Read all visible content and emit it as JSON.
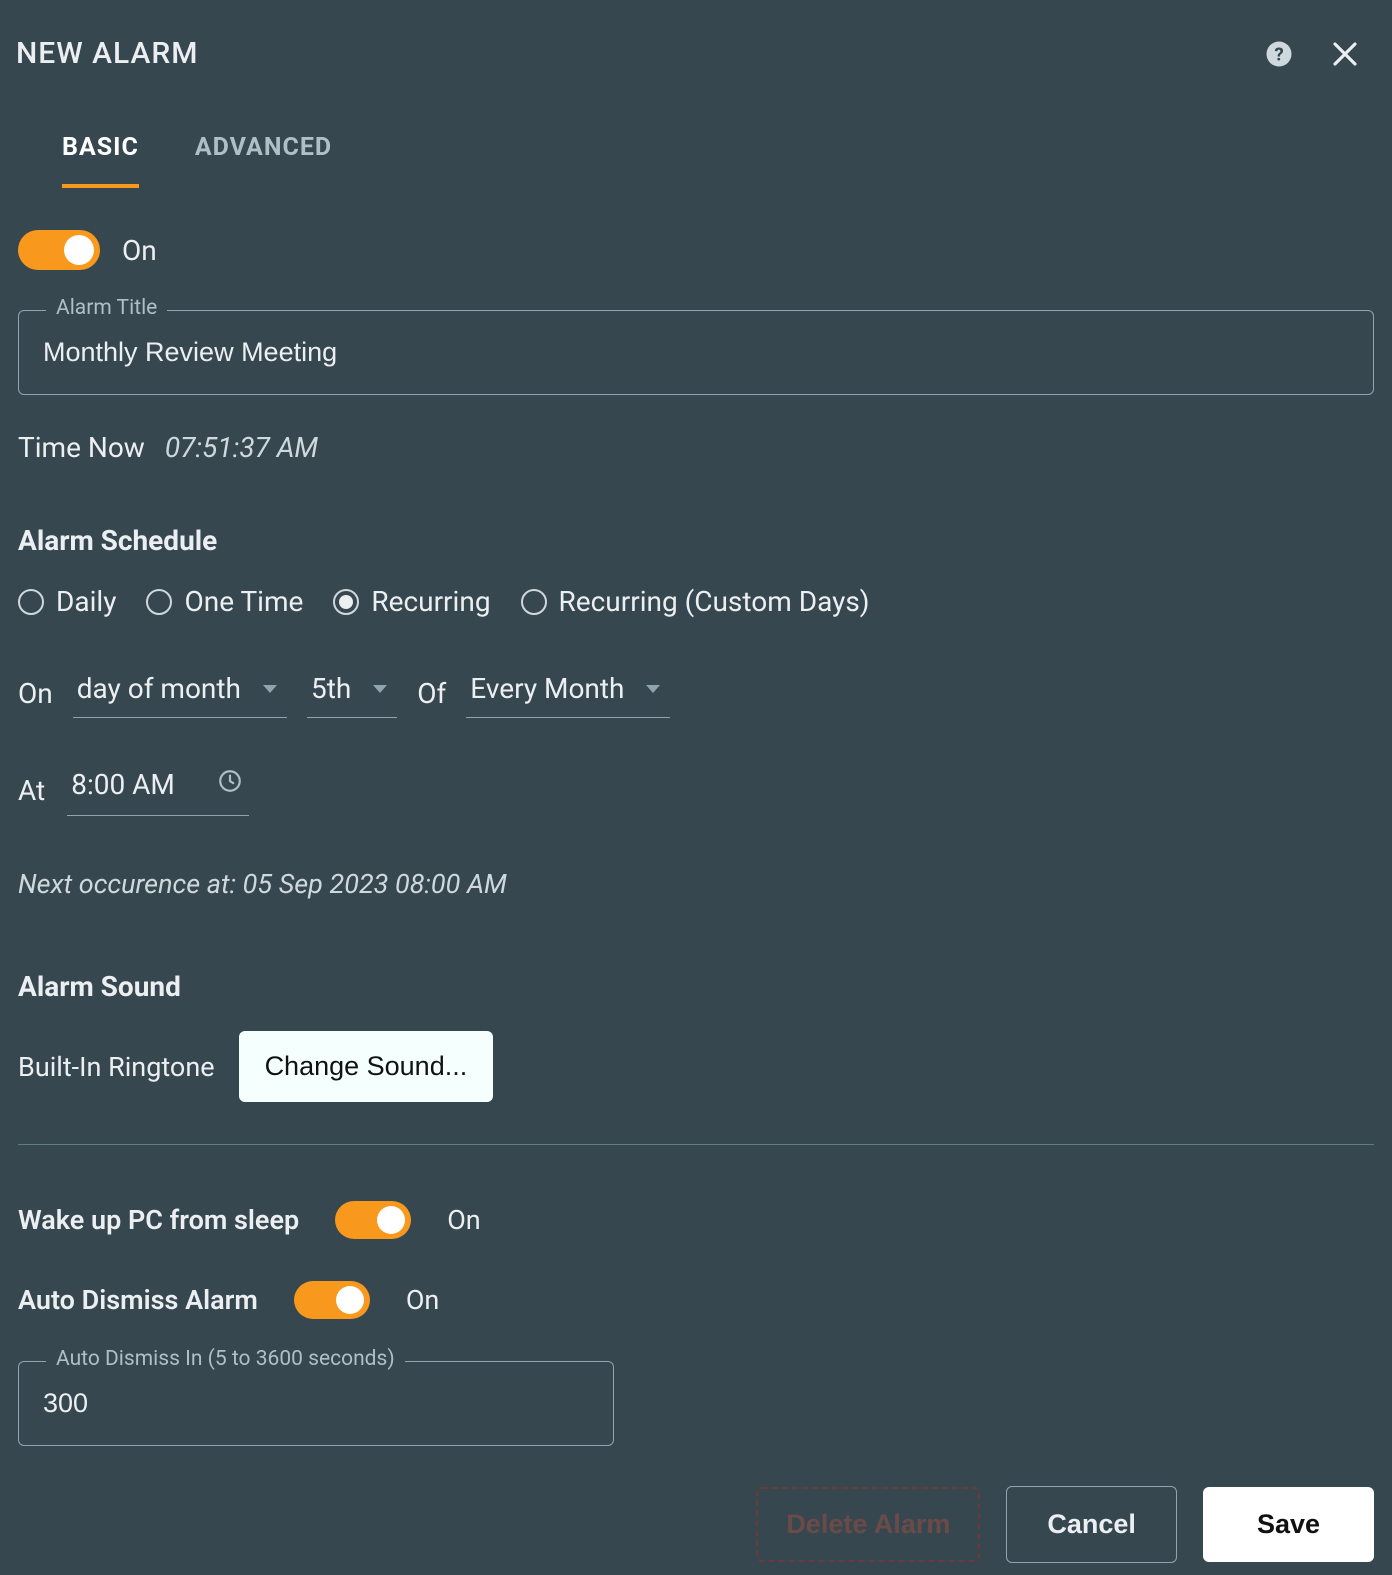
{
  "header": {
    "title": "NEW ALARM"
  },
  "tabs": {
    "basic": "BASIC",
    "advanced": "ADVANCED"
  },
  "enabled": {
    "label": "On"
  },
  "title_field": {
    "label": "Alarm Title",
    "value": "Monthly Review Meeting"
  },
  "time_now": {
    "label": "Time Now",
    "value": "07:51:37 AM"
  },
  "schedule": {
    "heading": "Alarm Schedule",
    "options": {
      "daily": "Daily",
      "one_time": "One Time",
      "recurring": "Recurring",
      "recurring_custom": "Recurring (Custom Days)"
    },
    "selected": "recurring",
    "on_label": "On",
    "on_mode": "day of month",
    "ordinal": "5th",
    "of_label": "Of",
    "period": "Every Month",
    "at_label": "At",
    "at_time": "8:00 AM",
    "next_label": "Next occurence at: 05 Sep 2023 08:00 AM"
  },
  "sound": {
    "heading": "Alarm Sound",
    "current": "Built-In Ringtone",
    "change_button": "Change Sound..."
  },
  "wake_pc": {
    "label": "Wake up PC from sleep",
    "state": "On"
  },
  "auto_dismiss": {
    "label": "Auto Dismiss Alarm",
    "state": "On",
    "field_label": "Auto Dismiss In (5 to 3600 seconds)",
    "value": "300"
  },
  "footer": {
    "delete": "Delete Alarm",
    "cancel": "Cancel",
    "save": "Save"
  }
}
